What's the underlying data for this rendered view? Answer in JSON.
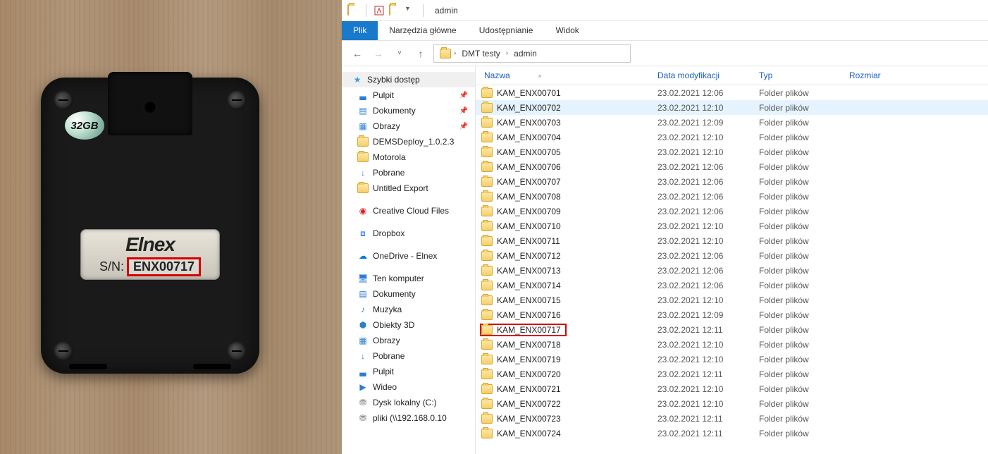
{
  "photo": {
    "storage_badge": "32GB",
    "brand": "Elnex",
    "sn_label": "S/N:",
    "sn_value": "ENX00717"
  },
  "titlebar": {
    "title": "admin"
  },
  "ribbon": {
    "file": "Plik",
    "tools": "Narzędzia główne",
    "share": "Udostępnianie",
    "view": "Widok"
  },
  "breadcrumb": {
    "seg1": "DMT testy",
    "seg2": "admin"
  },
  "nav": {
    "quick_access": "Szybki dostęp",
    "desktop": "Pulpit",
    "documents": "Dokumenty",
    "pictures": "Obrazy",
    "dems": "DEMSDeploy_1.0.2.3",
    "motorola": "Motorola",
    "downloads": "Pobrane",
    "untitled": "Untitled Export",
    "ccf": "Creative Cloud Files",
    "dropbox": "Dropbox",
    "onedrive": "OneDrive - Elnex",
    "this_pc": "Ten komputer",
    "pc_documents": "Dokumenty",
    "pc_music": "Muzyka",
    "pc_3d": "Obiekty 3D",
    "pc_pictures": "Obrazy",
    "pc_downloads": "Pobrane",
    "pc_desktop": "Pulpit",
    "pc_videos": "Wideo",
    "pc_disk": "Dysk lokalny (C:)",
    "pc_net": "pliki (\\\\192.168.0.10"
  },
  "columns": {
    "name": "Nazwa",
    "date": "Data modyfikacji",
    "type": "Typ",
    "size": "Rozmiar"
  },
  "type_label": "Folder plików",
  "rows": [
    {
      "name": "KAM_ENX00701",
      "date": "23.02.2021 12:06",
      "hovered": false,
      "highlighted": false
    },
    {
      "name": "KAM_ENX00702",
      "date": "23.02.2021 12:10",
      "hovered": true,
      "highlighted": false
    },
    {
      "name": "KAM_ENX00703",
      "date": "23.02.2021 12:09",
      "hovered": false,
      "highlighted": false
    },
    {
      "name": "KAM_ENX00704",
      "date": "23.02.2021 12:10",
      "hovered": false,
      "highlighted": false
    },
    {
      "name": "KAM_ENX00705",
      "date": "23.02.2021 12:10",
      "hovered": false,
      "highlighted": false
    },
    {
      "name": "KAM_ENX00706",
      "date": "23.02.2021 12:06",
      "hovered": false,
      "highlighted": false
    },
    {
      "name": "KAM_ENX00707",
      "date": "23.02.2021 12:06",
      "hovered": false,
      "highlighted": false
    },
    {
      "name": "KAM_ENX00708",
      "date": "23.02.2021 12:06",
      "hovered": false,
      "highlighted": false
    },
    {
      "name": "KAM_ENX00709",
      "date": "23.02.2021 12:06",
      "hovered": false,
      "highlighted": false
    },
    {
      "name": "KAM_ENX00710",
      "date": "23.02.2021 12:10",
      "hovered": false,
      "highlighted": false
    },
    {
      "name": "KAM_ENX00711",
      "date": "23.02.2021 12:10",
      "hovered": false,
      "highlighted": false
    },
    {
      "name": "KAM_ENX00712",
      "date": "23.02.2021 12:06",
      "hovered": false,
      "highlighted": false
    },
    {
      "name": "KAM_ENX00713",
      "date": "23.02.2021 12:06",
      "hovered": false,
      "highlighted": false
    },
    {
      "name": "KAM_ENX00714",
      "date": "23.02.2021 12:06",
      "hovered": false,
      "highlighted": false
    },
    {
      "name": "KAM_ENX00715",
      "date": "23.02.2021 12:10",
      "hovered": false,
      "highlighted": false
    },
    {
      "name": "KAM_ENX00716",
      "date": "23.02.2021 12:09",
      "hovered": false,
      "highlighted": false
    },
    {
      "name": "KAM_ENX00717",
      "date": "23.02.2021 12:11",
      "hovered": false,
      "highlighted": true
    },
    {
      "name": "KAM_ENX00718",
      "date": "23.02.2021 12:10",
      "hovered": false,
      "highlighted": false
    },
    {
      "name": "KAM_ENX00719",
      "date": "23.02.2021 12:10",
      "hovered": false,
      "highlighted": false
    },
    {
      "name": "KAM_ENX00720",
      "date": "23.02.2021 12:11",
      "hovered": false,
      "highlighted": false
    },
    {
      "name": "KAM_ENX00721",
      "date": "23.02.2021 12:10",
      "hovered": false,
      "highlighted": false
    },
    {
      "name": "KAM_ENX00722",
      "date": "23.02.2021 12:10",
      "hovered": false,
      "highlighted": false
    },
    {
      "name": "KAM_ENX00723",
      "date": "23.02.2021 12:11",
      "hovered": false,
      "highlighted": false
    },
    {
      "name": "KAM_ENX00724",
      "date": "23.02.2021 12:11",
      "hovered": false,
      "highlighted": false
    }
  ]
}
